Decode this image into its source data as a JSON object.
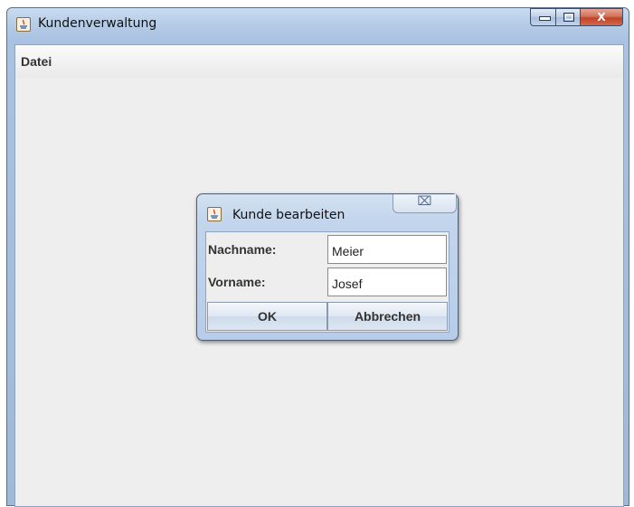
{
  "window": {
    "title": "Kundenverwaltung",
    "icon": "java-icon",
    "controls": {
      "minimize": "minimize-icon",
      "maximize": "maximize-icon",
      "close_glyph": "X"
    }
  },
  "menubar": {
    "items": [
      {
        "label": "Datei"
      }
    ]
  },
  "dialog": {
    "title": "Kunde bearbeiten",
    "icon": "java-icon",
    "close_glyph": "⌧",
    "fields": [
      {
        "label": "Nachname:",
        "value": "Meier"
      },
      {
        "label": "Vorname:",
        "value": "Josef"
      }
    ],
    "buttons": {
      "ok": "OK",
      "cancel": "Abbrechen"
    }
  },
  "colors": {
    "accent": "#c0432a",
    "titlebar": "#b4cbe6",
    "panel": "#eeeeee"
  }
}
